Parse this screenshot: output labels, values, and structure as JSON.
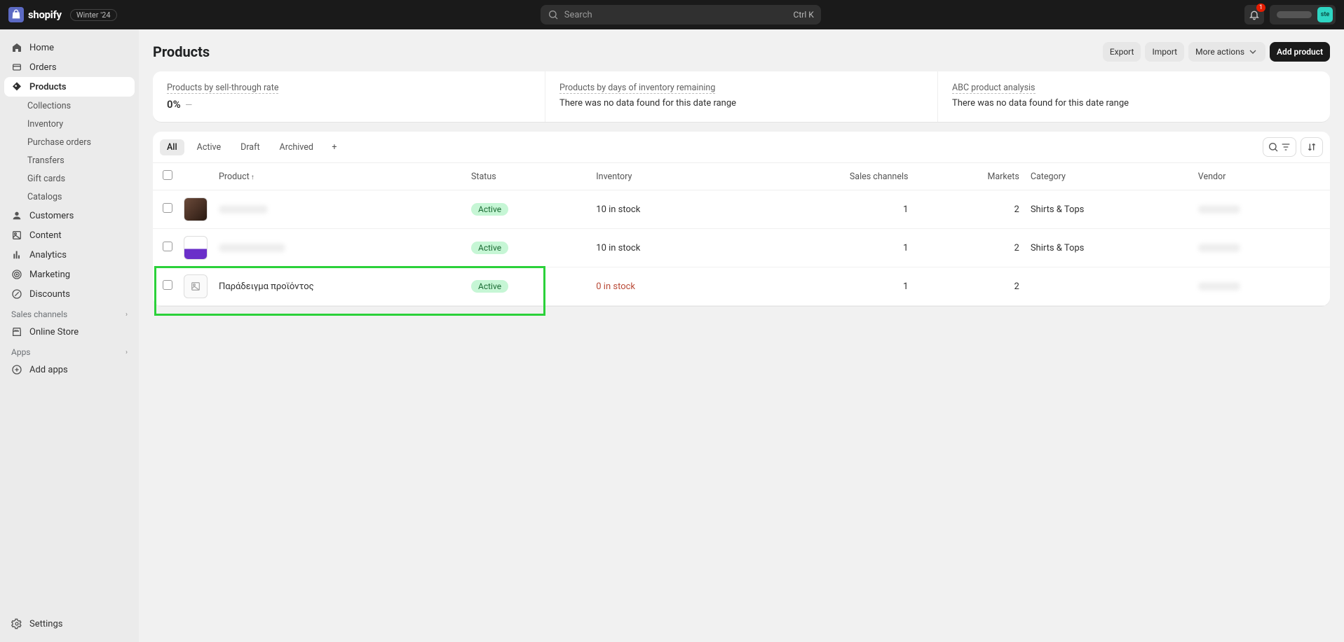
{
  "topbar": {
    "brand": "shopify",
    "edition_badge": "Winter '24",
    "search_placeholder": "Search",
    "search_kbd": "Ctrl K",
    "notification_count": "1",
    "avatar_initials": "ste"
  },
  "sidebar": {
    "items": [
      {
        "label": "Home"
      },
      {
        "label": "Orders"
      },
      {
        "label": "Products"
      },
      {
        "label": "Customers"
      },
      {
        "label": "Content"
      },
      {
        "label": "Analytics"
      },
      {
        "label": "Marketing"
      },
      {
        "label": "Discounts"
      }
    ],
    "product_sub": [
      {
        "label": "Collections"
      },
      {
        "label": "Inventory"
      },
      {
        "label": "Purchase orders"
      },
      {
        "label": "Transfers"
      },
      {
        "label": "Gift cards"
      },
      {
        "label": "Catalogs"
      }
    ],
    "sales_channels_label": "Sales channels",
    "online_store_label": "Online Store",
    "apps_label": "Apps",
    "add_apps_label": "Add apps",
    "settings_label": "Settings"
  },
  "page": {
    "title": "Products",
    "actions": {
      "export": "Export",
      "import": "Import",
      "more": "More actions",
      "add": "Add product"
    }
  },
  "metrics": [
    {
      "label": "Products by sell-through rate",
      "value": "0%",
      "spark": "—"
    },
    {
      "label": "Products by days of inventory remaining",
      "note": "There was no data found for this date range"
    },
    {
      "label": "ABC product analysis",
      "note": "There was no data found for this date range"
    }
  ],
  "tabs": [
    "All",
    "Active",
    "Draft",
    "Archived"
  ],
  "table": {
    "headers": {
      "product": "Product",
      "status": "Status",
      "inventory": "Inventory",
      "sales_channels": "Sales channels",
      "markets": "Markets",
      "category": "Category",
      "vendor": "Vendor"
    },
    "rows": [
      {
        "name": "",
        "status": "Active",
        "inventory": "10 in stock",
        "sales_channels": "1",
        "markets": "2",
        "category": "Shirts & Tops",
        "blur": true,
        "thumb": "brown"
      },
      {
        "name": "",
        "status": "Active",
        "inventory": "10 in stock",
        "sales_channels": "1",
        "markets": "2",
        "category": "Shirts & Tops",
        "blur": true,
        "thumb": "purple"
      },
      {
        "name": "Παράδειγμα προϊόντος",
        "status": "Active",
        "inventory": "0 in stock",
        "inv_zero": true,
        "sales_channels": "1",
        "markets": "2",
        "category": "",
        "thumb": "empty",
        "highlight": true
      }
    ]
  }
}
